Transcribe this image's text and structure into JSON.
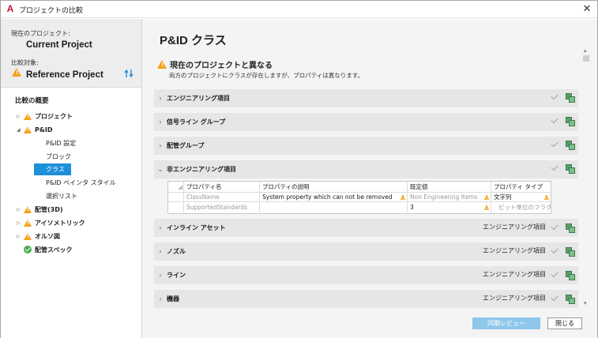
{
  "window": {
    "title": "プロジェクトの比較",
    "app_icon": "A"
  },
  "left": {
    "current_label": "現在のプロジェクト:",
    "current_name": "Current Project",
    "compare_label": "比較対象:",
    "compare_name": "Reference Project",
    "overview_title": "比較の概要",
    "tree": [
      {
        "label": "プロジェクト",
        "expander": "▷",
        "warn": true
      },
      {
        "label": "P&ID",
        "expander": "◢",
        "warn": true
      },
      {
        "label": "P&ID 設定"
      },
      {
        "label": "ブロック"
      },
      {
        "label": "クラス",
        "selected": true
      },
      {
        "label": "P&ID ペインタ スタイル"
      },
      {
        "label": "選択リスト"
      },
      {
        "label": "配管(3D)",
        "expander": "▷",
        "warn": true
      },
      {
        "label": "アイソメトリック",
        "expander": "▷",
        "warn": true
      },
      {
        "label": "オルソ図",
        "expander": "▷",
        "warn": true
      },
      {
        "label": "配管スペック",
        "ok": true
      }
    ]
  },
  "main": {
    "title": "P&ID クラス",
    "diff_heading": "現在のプロジェクトと異なる",
    "diff_sub": "両方のプロジェクトにクラスが存在しますが、プロパティは異なります。",
    "sections": [
      {
        "label": "エンジニアリング項目",
        "chevron": "›",
        "right_text": ""
      },
      {
        "label": "信号ライン グループ",
        "chevron": "›",
        "right_text": ""
      },
      {
        "label": "配管グループ",
        "chevron": "›",
        "right_text": ""
      },
      {
        "label": "非エンジニアリング項目",
        "chevron": "⌄",
        "right_text": ""
      },
      {
        "label": "インライン アセット",
        "chevron": "›",
        "right_text": "エンジニアリング項目"
      },
      {
        "label": "ノズル",
        "chevron": "›",
        "right_text": "エンジニアリング項目"
      },
      {
        "label": "ライン",
        "chevron": "›",
        "right_text": "エンジニアリング項目"
      },
      {
        "label": "機器",
        "chevron": "›",
        "right_text": "エンジニアリング項目"
      }
    ],
    "table": {
      "headers": [
        "プロパティ名",
        "プロパティの説明",
        "既定値",
        "プロパティ タイプ"
      ],
      "rows": [
        [
          "ClassName",
          "System property which can not be removed",
          "Non Engineering Items",
          "文字列"
        ],
        [
          "SupportedStandards",
          "",
          "3",
          "ビット単位のフラグ"
        ]
      ]
    }
  },
  "buttons": {
    "sync_review": "同期レビュー",
    "close": "閉じる"
  },
  "colors": {
    "warning": "#f2a21b",
    "selection": "#1e8fd9",
    "primary_button": "#8ec7ea"
  }
}
